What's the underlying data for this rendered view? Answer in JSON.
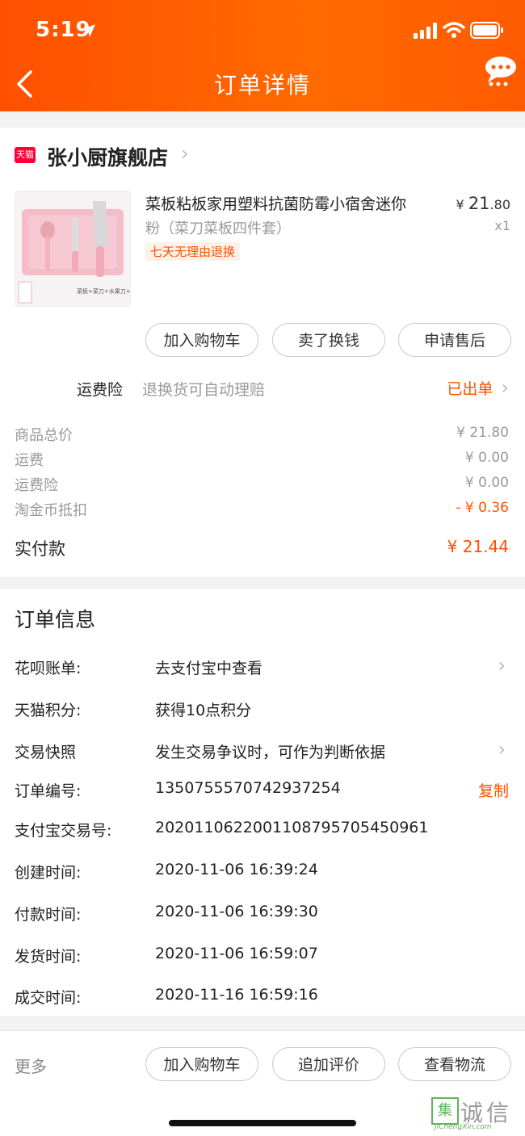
{
  "status_bar": {
    "time": "5:19"
  },
  "nav": {
    "title": "订单详情"
  },
  "shop": {
    "badge": "天猫",
    "name": "张小厨旗舰店"
  },
  "product": {
    "title": "菜板粘板家用塑料抗菌防霉小宿舍迷你",
    "spec": "粉（菜刀菜板四件套）",
    "tag": "七天无理由退换",
    "price_int": "21",
    "price_dec": ".80",
    "currency": "¥",
    "quantity": "x1",
    "thumb_caption": "菜板+菜刀+水果刀+陶瓷刨"
  },
  "item_actions": [
    "加入购物车",
    "卖了换钱",
    "申请售后"
  ],
  "insurance": {
    "label": "运费险",
    "desc": "退换货可自动理赔",
    "status": "已出单"
  },
  "price_summary": {
    "rows": [
      {
        "label": "商品总价",
        "value": "¥ 21.80"
      },
      {
        "label": "运费",
        "value": "¥ 0.00"
      },
      {
        "label": "运费险",
        "value": "¥ 0.00"
      },
      {
        "label": "淘金币抵扣",
        "value": "- ¥ 0.36"
      }
    ],
    "paid_label": "实付款",
    "paid_value": "¥ 21.44"
  },
  "order_info": {
    "title": "订单信息",
    "rows": [
      {
        "label": "花呗账单:",
        "value": "去支付宝中查看"
      },
      {
        "label": "天猫积分:",
        "value": "获得10点积分"
      },
      {
        "label": "交易快照",
        "value": "发生交易争议时，可作为判断依据"
      },
      {
        "label": "订单编号:",
        "value": "1350755570742937254"
      },
      {
        "label": "支付宝交易号:",
        "value": "2020110622001108795705450961"
      },
      {
        "label": "创建时间:",
        "value": "2020-11-06 16:39:24"
      },
      {
        "label": "付款时间:",
        "value": "2020-11-06 16:39:30"
      },
      {
        "label": "发货时间:",
        "value": "2020-11-06 16:59:07"
      },
      {
        "label": "成交时间:",
        "value": "2020-11-16 16:59:16"
      }
    ],
    "copy_label": "复制"
  },
  "bottom_bar": {
    "more": "更多",
    "buttons": [
      "加入购物车",
      "追加评价",
      "查看物流"
    ]
  },
  "watermark": {
    "text": "诚信",
    "sub": "JiChengXin.com"
  },
  "colors": {
    "accent": "#ff5000",
    "header": "#ff5a00"
  }
}
